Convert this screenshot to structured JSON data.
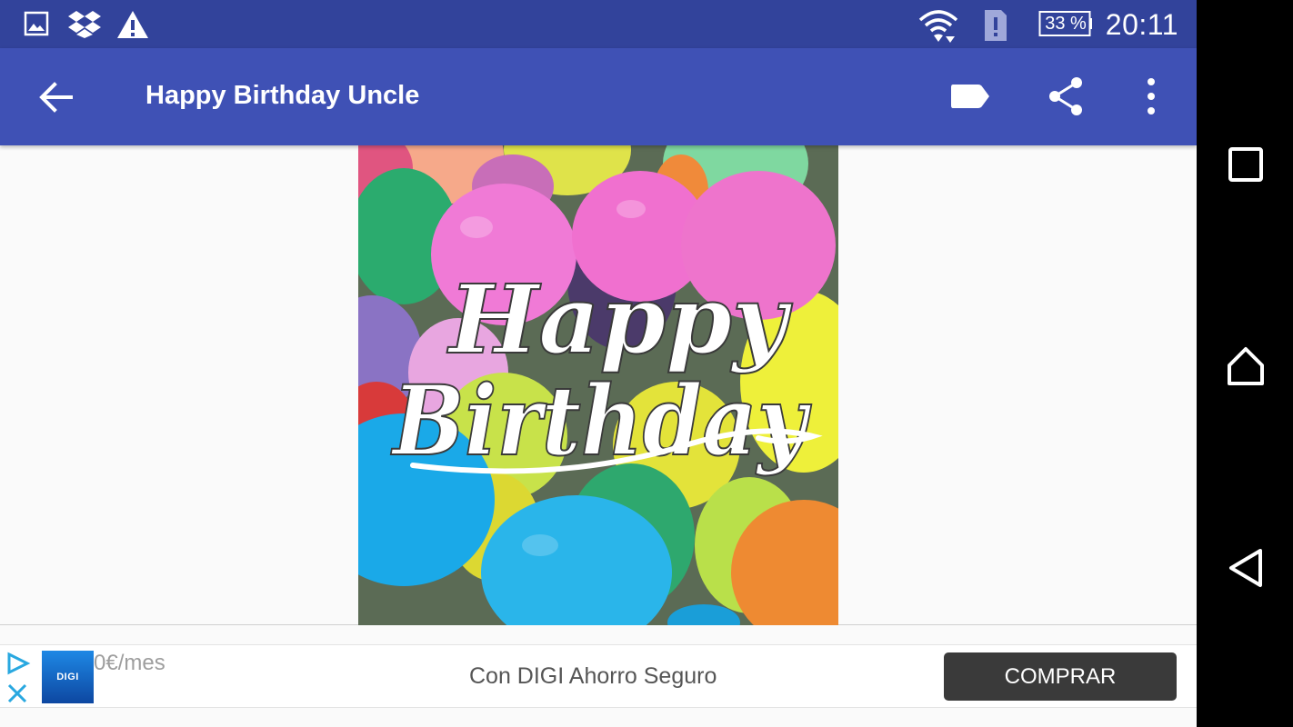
{
  "status_bar": {
    "icons": [
      "gallery-icon",
      "dropbox-icon",
      "warning-icon",
      "wifi-icon",
      "sim-alert-icon",
      "battery-icon"
    ],
    "battery_text": "33 %",
    "time": "20:11"
  },
  "app_bar": {
    "title": "Happy Birthday Uncle",
    "actions": [
      "label-icon",
      "share-icon",
      "more-vert-icon"
    ]
  },
  "card": {
    "line1": "Happy",
    "line2": "Birthday"
  },
  "ad": {
    "logo_text": "DIGI",
    "price_text": "0€/mes",
    "headline": "Con DIGI Ahorro Seguro",
    "cta": "COMPRAR"
  },
  "nav_bar": {
    "buttons": [
      "recents-icon",
      "home-icon",
      "back-nav-icon"
    ]
  },
  "colors": {
    "status_bar": "#32439b",
    "app_bar": "#3f51b5",
    "cta": "#3a3a3a"
  }
}
